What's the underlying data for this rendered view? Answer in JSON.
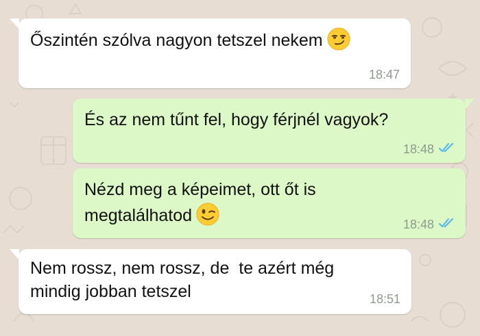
{
  "colors": {
    "wallpaper": "#e7ddd3",
    "incoming_bubble": "#ffffff",
    "outgoing_bubble": "#dcf8c6",
    "timestamp": "#8f9a8f",
    "read_ticks": "#4fb6ec"
  },
  "messages": [
    {
      "direction": "incoming",
      "text": "Őszintén szólva nagyon tetszel nekem",
      "emoji": "smirking-face",
      "time": "18:47"
    },
    {
      "direction": "outgoing",
      "text": "És az nem tűnt fel, hogy férjnél vagyok?",
      "time": "18:48",
      "status": "read-double-check"
    },
    {
      "direction": "outgoing",
      "text_line1": "Nézd meg a képeimet, ott őt is",
      "text_line2": "megtalálhatod",
      "emoji": "winking-face",
      "time": "18:48",
      "status": "read-double-check"
    },
    {
      "direction": "incoming",
      "text_line1": "Nem rossz, nem rossz, de  te azért még",
      "text_line2": "mindig jobban tetszel",
      "time": "18:51"
    }
  ]
}
